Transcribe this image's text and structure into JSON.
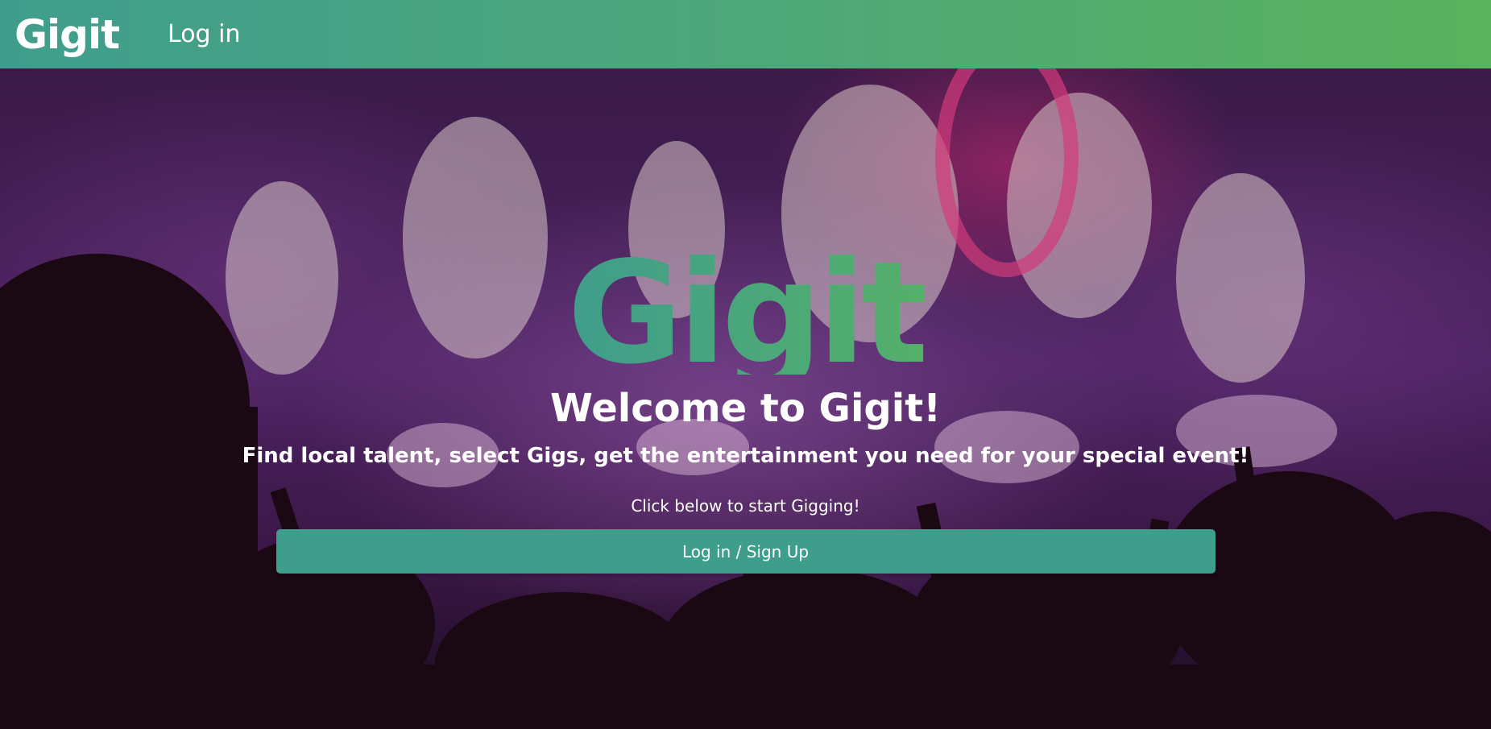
{
  "navbar": {
    "brand": "Gigit",
    "login_label": "Log in",
    "gradient": [
      "#3f9d8c",
      "#5ab35d"
    ]
  },
  "hero": {
    "logo_text": "Gigit",
    "title": "Welcome to Gigit!",
    "tagline": "Find local talent, select Gigs, get the entertainment you need for your special event!",
    "cta_text": "Click below to start Gigging!",
    "cta_button_label": "Log in / Sign Up",
    "button_color": "#3f9d8c",
    "background_description_icon": "concert-crowd-fireworks-background"
  }
}
